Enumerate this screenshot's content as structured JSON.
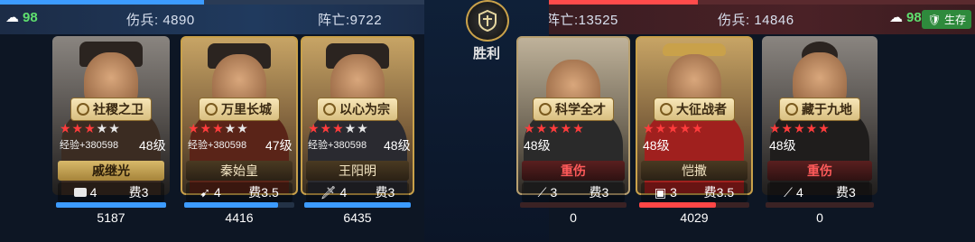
{
  "left_side": {
    "green_count": "98",
    "wounded_label": "伤兵: 4890",
    "dead_label": "阵亡:9722",
    "progress": 0.48
  },
  "right_side": {
    "dead_label": "阵亡:13525",
    "wounded_label": "伤兵: 14846",
    "green_count": "98",
    "status_badge": "生存",
    "progress": 0.35
  },
  "center": {
    "result": "胜利"
  },
  "colors": {
    "ally": "#3c9bff",
    "enemy": "#ff4646",
    "gold": "#c9a14a",
    "survive": "#2e8a3c"
  },
  "left_heroes": [
    {
      "skill": "社稷之卫",
      "stars_on": 3,
      "exp": "经验+380598",
      "level": "48级",
      "name": "戚继光",
      "troop": "4",
      "cost": "费3",
      "hp": "5187",
      "hp_ratio": 1.0
    },
    {
      "skill": "万里长城",
      "stars_on": 3,
      "exp": "经验+380598",
      "level": "47级",
      "name": "秦始皇",
      "troop": "4",
      "cost": "费3.5",
      "hp": "4416",
      "hp_ratio": 0.85
    },
    {
      "skill": "以心为宗",
      "stars_on": 3,
      "exp": "经验+380598",
      "level": "48级",
      "name": "王阳明",
      "troop": "4",
      "cost": "费3",
      "hp": "6435",
      "hp_ratio": 1.0
    }
  ],
  "right_heroes": [
    {
      "skill": "科学全才",
      "stars_on": 5,
      "level": "48级",
      "name": "重伤",
      "troop": "3",
      "cost": "费3",
      "hp": "0",
      "hp_ratio": 0.0
    },
    {
      "skill": "大征战者",
      "stars_on": 5,
      "level": "48级",
      "name": "恺撒",
      "troop": "3",
      "cost": "费3.5",
      "hp": "4029",
      "hp_ratio": 0.7
    },
    {
      "skill": "藏于九地",
      "stars_on": 5,
      "level": "48级",
      "name": "重伤",
      "troop": "4",
      "cost": "费3",
      "hp": "0",
      "hp_ratio": 0.0
    }
  ]
}
